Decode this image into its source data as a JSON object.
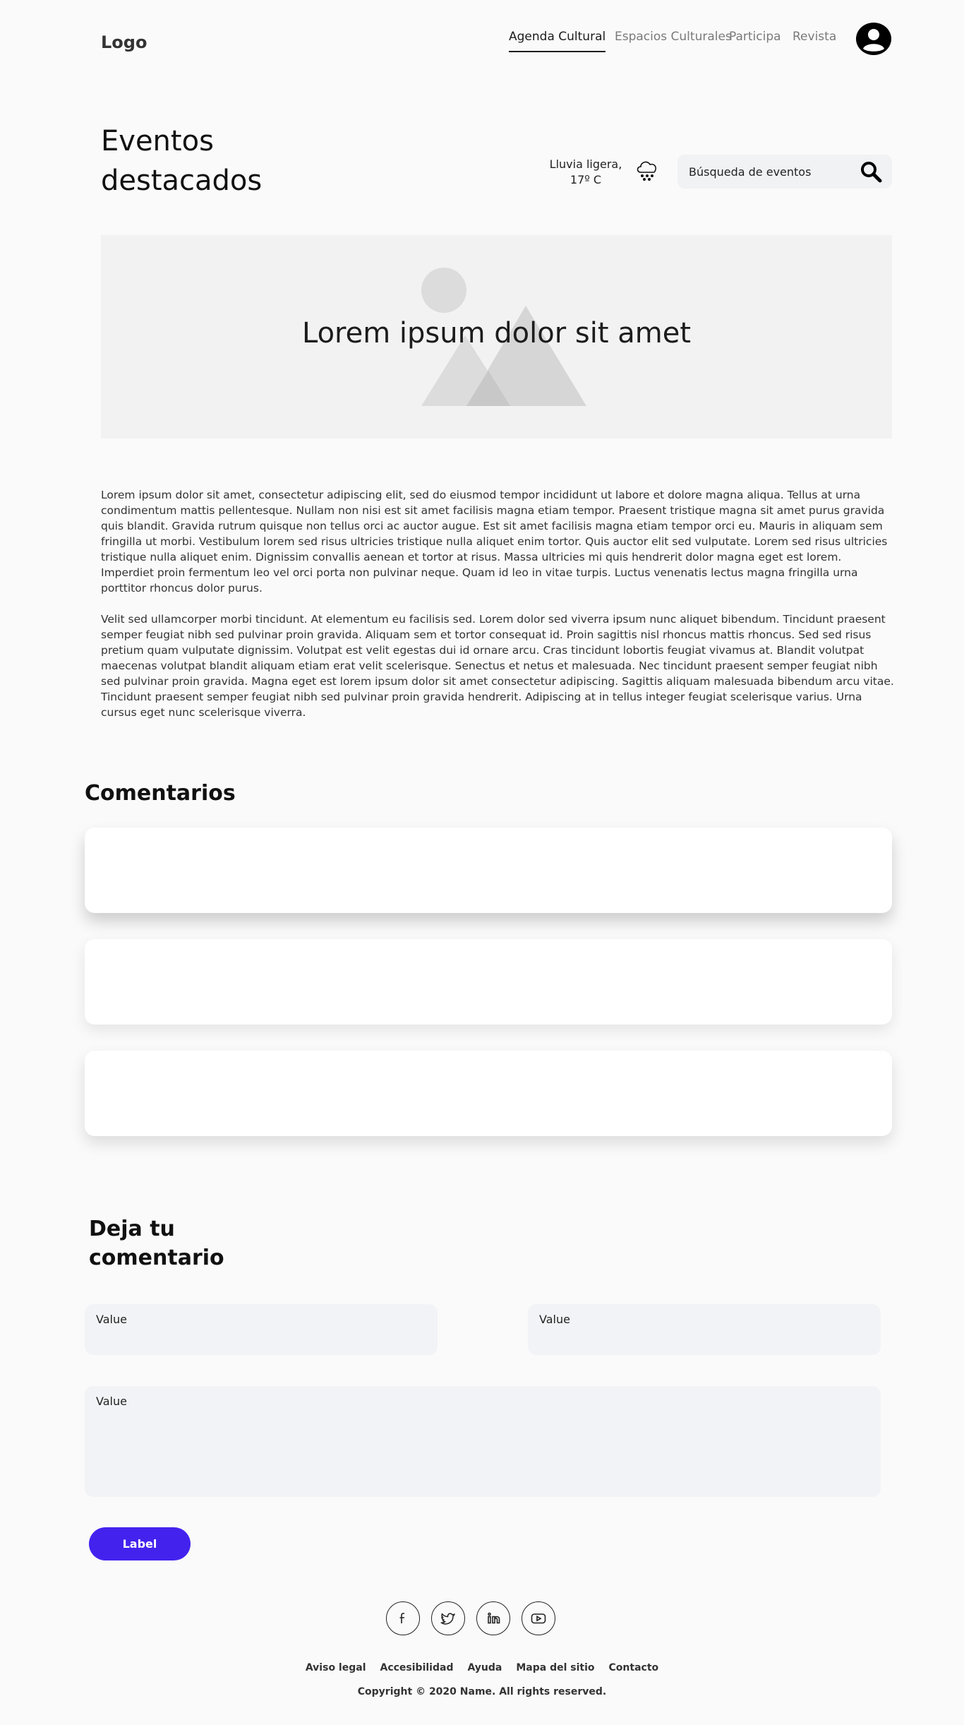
{
  "header": {
    "logo": "Logo",
    "nav": [
      "Agenda Cultural",
      "Espacios Culturales",
      "Participa",
      "Revista"
    ],
    "active_nav": "Agenda Cultural"
  },
  "title_row": {
    "title": "Eventos destacados",
    "weather": "Lluvia ligera, 17º C",
    "weather_icon": "rain-cloud-icon",
    "search_placeholder": "Búsqueda de eventos"
  },
  "hero": {
    "title": "Lorem ipsum dolor sit amet"
  },
  "article": {
    "paragraphs": [
      "Lorem ipsum dolor sit amet, consectetur adipiscing elit, sed do eiusmod tempor incididunt ut labore et dolore magna aliqua. Tellus at urna condimentum mattis pellentesque. Nullam non nisi est sit amet facilisis magna etiam tempor. Praesent tristique magna sit amet purus gravida quis blandit. Gravida rutrum quisque non tellus orci ac auctor augue. Est sit amet facilisis magna etiam tempor orci eu. Mauris in aliquam sem fringilla ut morbi. Vestibulum lorem sed risus ultricies tristique nulla aliquet enim tortor. Quis auctor elit sed vulputate. Lorem sed risus ultricies tristique nulla aliquet enim. Dignissim convallis aenean et tortor at risus. Massa ultricies mi quis hendrerit dolor magna eget est lorem. Imperdiet proin fermentum leo vel orci porta non pulvinar neque. Quam id leo in vitae turpis. Luctus venenatis lectus magna fringilla urna porttitor rhoncus dolor purus.",
      "Velit sed ullamcorper morbi tincidunt. At elementum eu facilisis sed. Lorem dolor sed viverra ipsum nunc aliquet bibendum. Tincidunt praesent semper feugiat nibh sed pulvinar proin gravida. Aliquam sem et tortor consequat id. Proin sagittis nisl rhoncus mattis rhoncus. Sed sed risus pretium quam vulputate dignissim. Volutpat est velit egestas dui id ornare arcu. Cras tincidunt lobortis feugiat vivamus at. Blandit volutpat maecenas volutpat blandit aliquam etiam erat velit scelerisque. Senectus et netus et malesuada. Nec tincidunt praesent semper feugiat nibh sed pulvinar proin gravida. Magna eget est lorem ipsum dolor sit amet consectetur adipiscing. Sagittis aliquam malesuada bibendum arcu vitae. Tincidunt praesent semper feugiat nibh sed pulvinar proin gravida hendrerit. Adipiscing at in tellus integer feugiat scelerisque varius. Urna cursus eget nunc scelerisque viverra."
    ]
  },
  "comments": {
    "title": "Comentarios",
    "count": 3
  },
  "form": {
    "title": "Deja tu comentario",
    "field1_label": "Value",
    "field2_label": "Value",
    "message_label": "Value",
    "submit_label": "Label"
  },
  "footer": {
    "social": [
      "facebook-icon",
      "twitter-icon",
      "linkedin-icon",
      "youtube-icon"
    ],
    "links": [
      "Aviso legal",
      "Accesibilidad",
      "Ayuda",
      "Mapa del sitio",
      "Contacto"
    ],
    "copyright": "Copyright © 2020 Name. All rights reserved."
  },
  "colors": {
    "background": "#fafafa",
    "accent": "#4422ee",
    "field_bg": "#f2f3f6",
    "hero_bg": "#f2f2f2"
  }
}
